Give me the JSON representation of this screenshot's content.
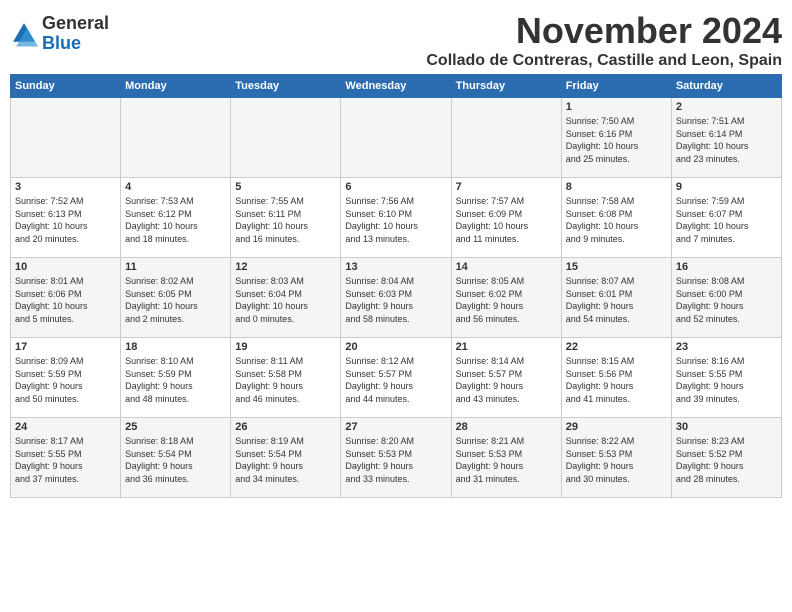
{
  "header": {
    "logo_general": "General",
    "logo_blue": "Blue",
    "month_title": "November 2024",
    "location": "Collado de Contreras, Castille and Leon, Spain"
  },
  "weekdays": [
    "Sunday",
    "Monday",
    "Tuesday",
    "Wednesday",
    "Thursday",
    "Friday",
    "Saturday"
  ],
  "weeks": [
    [
      {
        "day": "",
        "info": ""
      },
      {
        "day": "",
        "info": ""
      },
      {
        "day": "",
        "info": ""
      },
      {
        "day": "",
        "info": ""
      },
      {
        "day": "",
        "info": ""
      },
      {
        "day": "1",
        "info": "Sunrise: 7:50 AM\nSunset: 6:16 PM\nDaylight: 10 hours\nand 25 minutes."
      },
      {
        "day": "2",
        "info": "Sunrise: 7:51 AM\nSunset: 6:14 PM\nDaylight: 10 hours\nand 23 minutes."
      }
    ],
    [
      {
        "day": "3",
        "info": "Sunrise: 7:52 AM\nSunset: 6:13 PM\nDaylight: 10 hours\nand 20 minutes."
      },
      {
        "day": "4",
        "info": "Sunrise: 7:53 AM\nSunset: 6:12 PM\nDaylight: 10 hours\nand 18 minutes."
      },
      {
        "day": "5",
        "info": "Sunrise: 7:55 AM\nSunset: 6:11 PM\nDaylight: 10 hours\nand 16 minutes."
      },
      {
        "day": "6",
        "info": "Sunrise: 7:56 AM\nSunset: 6:10 PM\nDaylight: 10 hours\nand 13 minutes."
      },
      {
        "day": "7",
        "info": "Sunrise: 7:57 AM\nSunset: 6:09 PM\nDaylight: 10 hours\nand 11 minutes."
      },
      {
        "day": "8",
        "info": "Sunrise: 7:58 AM\nSunset: 6:08 PM\nDaylight: 10 hours\nand 9 minutes."
      },
      {
        "day": "9",
        "info": "Sunrise: 7:59 AM\nSunset: 6:07 PM\nDaylight: 10 hours\nand 7 minutes."
      }
    ],
    [
      {
        "day": "10",
        "info": "Sunrise: 8:01 AM\nSunset: 6:06 PM\nDaylight: 10 hours\nand 5 minutes."
      },
      {
        "day": "11",
        "info": "Sunrise: 8:02 AM\nSunset: 6:05 PM\nDaylight: 10 hours\nand 2 minutes."
      },
      {
        "day": "12",
        "info": "Sunrise: 8:03 AM\nSunset: 6:04 PM\nDaylight: 10 hours\nand 0 minutes."
      },
      {
        "day": "13",
        "info": "Sunrise: 8:04 AM\nSunset: 6:03 PM\nDaylight: 9 hours\nand 58 minutes."
      },
      {
        "day": "14",
        "info": "Sunrise: 8:05 AM\nSunset: 6:02 PM\nDaylight: 9 hours\nand 56 minutes."
      },
      {
        "day": "15",
        "info": "Sunrise: 8:07 AM\nSunset: 6:01 PM\nDaylight: 9 hours\nand 54 minutes."
      },
      {
        "day": "16",
        "info": "Sunrise: 8:08 AM\nSunset: 6:00 PM\nDaylight: 9 hours\nand 52 minutes."
      }
    ],
    [
      {
        "day": "17",
        "info": "Sunrise: 8:09 AM\nSunset: 5:59 PM\nDaylight: 9 hours\nand 50 minutes."
      },
      {
        "day": "18",
        "info": "Sunrise: 8:10 AM\nSunset: 5:59 PM\nDaylight: 9 hours\nand 48 minutes."
      },
      {
        "day": "19",
        "info": "Sunrise: 8:11 AM\nSunset: 5:58 PM\nDaylight: 9 hours\nand 46 minutes."
      },
      {
        "day": "20",
        "info": "Sunrise: 8:12 AM\nSunset: 5:57 PM\nDaylight: 9 hours\nand 44 minutes."
      },
      {
        "day": "21",
        "info": "Sunrise: 8:14 AM\nSunset: 5:57 PM\nDaylight: 9 hours\nand 43 minutes."
      },
      {
        "day": "22",
        "info": "Sunrise: 8:15 AM\nSunset: 5:56 PM\nDaylight: 9 hours\nand 41 minutes."
      },
      {
        "day": "23",
        "info": "Sunrise: 8:16 AM\nSunset: 5:55 PM\nDaylight: 9 hours\nand 39 minutes."
      }
    ],
    [
      {
        "day": "24",
        "info": "Sunrise: 8:17 AM\nSunset: 5:55 PM\nDaylight: 9 hours\nand 37 minutes."
      },
      {
        "day": "25",
        "info": "Sunrise: 8:18 AM\nSunset: 5:54 PM\nDaylight: 9 hours\nand 36 minutes."
      },
      {
        "day": "26",
        "info": "Sunrise: 8:19 AM\nSunset: 5:54 PM\nDaylight: 9 hours\nand 34 minutes."
      },
      {
        "day": "27",
        "info": "Sunrise: 8:20 AM\nSunset: 5:53 PM\nDaylight: 9 hours\nand 33 minutes."
      },
      {
        "day": "28",
        "info": "Sunrise: 8:21 AM\nSunset: 5:53 PM\nDaylight: 9 hours\nand 31 minutes."
      },
      {
        "day": "29",
        "info": "Sunrise: 8:22 AM\nSunset: 5:53 PM\nDaylight: 9 hours\nand 30 minutes."
      },
      {
        "day": "30",
        "info": "Sunrise: 8:23 AM\nSunset: 5:52 PM\nDaylight: 9 hours\nand 28 minutes."
      }
    ]
  ]
}
